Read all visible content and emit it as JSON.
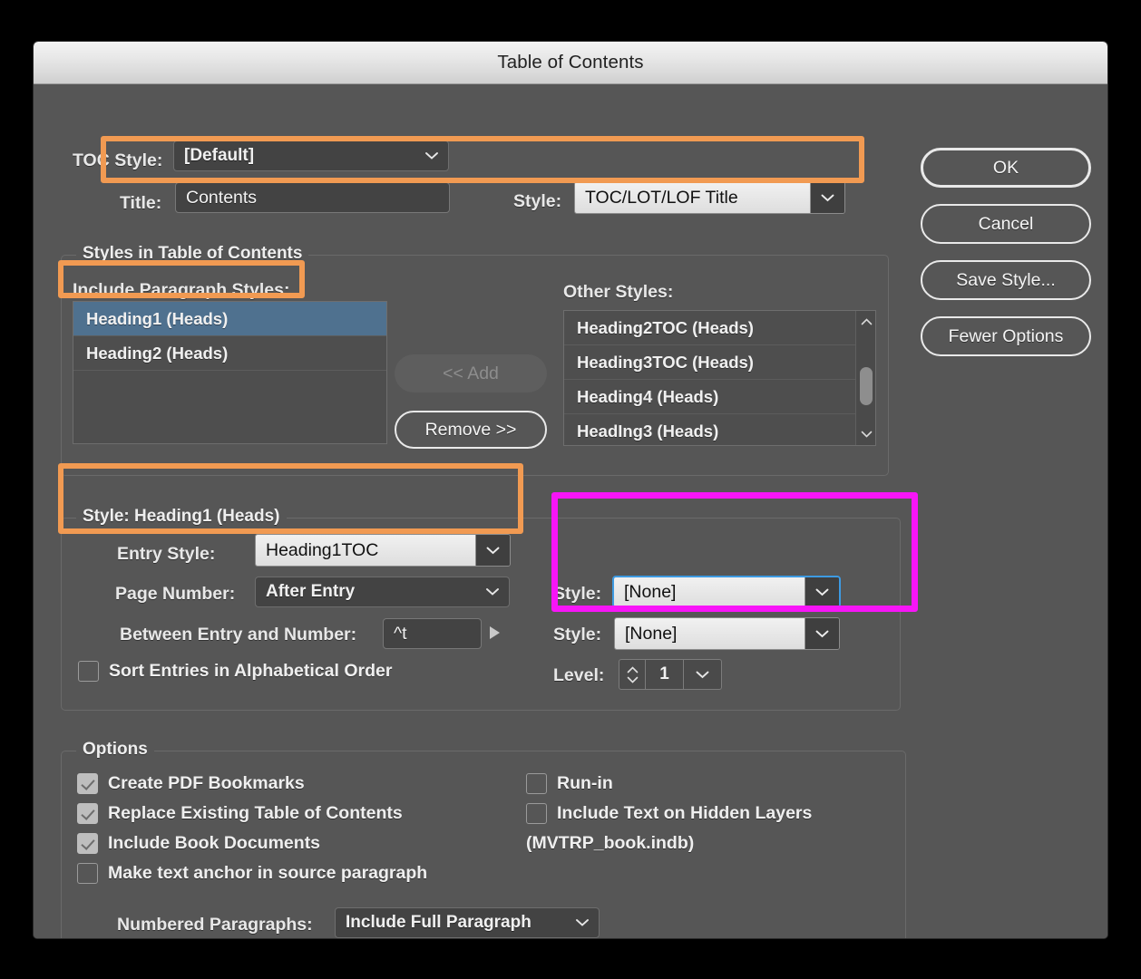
{
  "window": {
    "title": "Table of Contents"
  },
  "toc_style": {
    "label": "TOC Style:",
    "value": "[Default]"
  },
  "title_row": {
    "label": "Title:",
    "value": "Contents",
    "style_label": "Style:",
    "style_value": "TOC/LOT/LOF Title"
  },
  "buttons": {
    "ok": "OK",
    "cancel": "Cancel",
    "save_style": "Save Style...",
    "fewer_options": "Fewer Options"
  },
  "styles_group": {
    "title": "Styles in Table of Contents",
    "include_label": "Include Paragraph Styles:",
    "include_items": [
      {
        "text": "Heading1 (Heads)",
        "selected": true
      },
      {
        "text": "Heading2 (Heads)",
        "selected": false
      }
    ],
    "other_label": "Other Styles:",
    "other_items": [
      "Heading2TOC (Heads)",
      "Heading3TOC (Heads)",
      "Heading4 (Heads)",
      "HeadIng3 (Heads)"
    ],
    "add_button": "<< Add",
    "remove_button": "Remove >>"
  },
  "style_group": {
    "title": "Style: Heading1 (Heads)",
    "entry_style_label": "Entry Style:",
    "entry_style_value": "Heading1TOC",
    "page_number_label": "Page Number:",
    "page_number_value": "After Entry",
    "between_label": "Between Entry and Number:",
    "between_value": "^t",
    "sort_label": "Sort Entries in Alphabetical Order",
    "sort_checked": false,
    "right_style1_label": "Style:",
    "right_style1_value": "[None]",
    "right_style2_label": "Style:",
    "right_style2_value": "[None]",
    "level_label": "Level:",
    "level_value": "1"
  },
  "options_group": {
    "title": "Options",
    "left": [
      {
        "label": "Create PDF Bookmarks",
        "checked": true
      },
      {
        "label": "Replace Existing Table of Contents",
        "checked": true
      },
      {
        "label": "Include Book Documents",
        "checked": true
      },
      {
        "label": "Make text anchor in source paragraph",
        "checked": false
      }
    ],
    "right": [
      {
        "label": "Run-in",
        "checked": false
      },
      {
        "label": "Include Text on Hidden Layers",
        "checked": false
      }
    ],
    "book_name": "(MVTRP_book.indb)",
    "numbered_label": "Numbered Paragraphs:",
    "numbered_value": "Include Full Paragraph"
  },
  "colors": {
    "dialog_bg": "#565656",
    "selection_blue": "#4f718f",
    "annotation_orange": "#F19A52",
    "annotation_magenta": "#F715F7",
    "focus_blue": "#3d9ae2"
  }
}
